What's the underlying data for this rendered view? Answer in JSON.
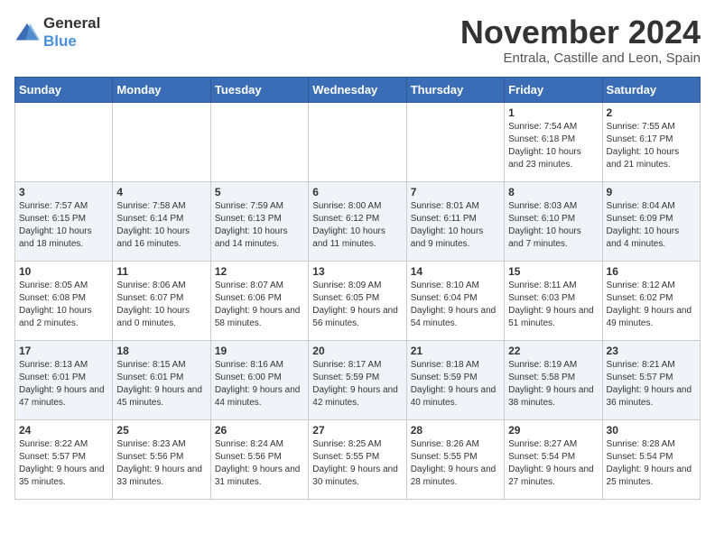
{
  "logo": {
    "general": "General",
    "blue": "Blue"
  },
  "title": "November 2024",
  "location": "Entrala, Castille and Leon, Spain",
  "days_of_week": [
    "Sunday",
    "Monday",
    "Tuesday",
    "Wednesday",
    "Thursday",
    "Friday",
    "Saturday"
  ],
  "weeks": [
    [
      {
        "day": "",
        "info": ""
      },
      {
        "day": "",
        "info": ""
      },
      {
        "day": "",
        "info": ""
      },
      {
        "day": "",
        "info": ""
      },
      {
        "day": "",
        "info": ""
      },
      {
        "day": "1",
        "info": "Sunrise: 7:54 AM\nSunset: 6:18 PM\nDaylight: 10 hours and 23 minutes."
      },
      {
        "day": "2",
        "info": "Sunrise: 7:55 AM\nSunset: 6:17 PM\nDaylight: 10 hours and 21 minutes."
      }
    ],
    [
      {
        "day": "3",
        "info": "Sunrise: 7:57 AM\nSunset: 6:15 PM\nDaylight: 10 hours and 18 minutes."
      },
      {
        "day": "4",
        "info": "Sunrise: 7:58 AM\nSunset: 6:14 PM\nDaylight: 10 hours and 16 minutes."
      },
      {
        "day": "5",
        "info": "Sunrise: 7:59 AM\nSunset: 6:13 PM\nDaylight: 10 hours and 14 minutes."
      },
      {
        "day": "6",
        "info": "Sunrise: 8:00 AM\nSunset: 6:12 PM\nDaylight: 10 hours and 11 minutes."
      },
      {
        "day": "7",
        "info": "Sunrise: 8:01 AM\nSunset: 6:11 PM\nDaylight: 10 hours and 9 minutes."
      },
      {
        "day": "8",
        "info": "Sunrise: 8:03 AM\nSunset: 6:10 PM\nDaylight: 10 hours and 7 minutes."
      },
      {
        "day": "9",
        "info": "Sunrise: 8:04 AM\nSunset: 6:09 PM\nDaylight: 10 hours and 4 minutes."
      }
    ],
    [
      {
        "day": "10",
        "info": "Sunrise: 8:05 AM\nSunset: 6:08 PM\nDaylight: 10 hours and 2 minutes."
      },
      {
        "day": "11",
        "info": "Sunrise: 8:06 AM\nSunset: 6:07 PM\nDaylight: 10 hours and 0 minutes."
      },
      {
        "day": "12",
        "info": "Sunrise: 8:07 AM\nSunset: 6:06 PM\nDaylight: 9 hours and 58 minutes."
      },
      {
        "day": "13",
        "info": "Sunrise: 8:09 AM\nSunset: 6:05 PM\nDaylight: 9 hours and 56 minutes."
      },
      {
        "day": "14",
        "info": "Sunrise: 8:10 AM\nSunset: 6:04 PM\nDaylight: 9 hours and 54 minutes."
      },
      {
        "day": "15",
        "info": "Sunrise: 8:11 AM\nSunset: 6:03 PM\nDaylight: 9 hours and 51 minutes."
      },
      {
        "day": "16",
        "info": "Sunrise: 8:12 AM\nSunset: 6:02 PM\nDaylight: 9 hours and 49 minutes."
      }
    ],
    [
      {
        "day": "17",
        "info": "Sunrise: 8:13 AM\nSunset: 6:01 PM\nDaylight: 9 hours and 47 minutes."
      },
      {
        "day": "18",
        "info": "Sunrise: 8:15 AM\nSunset: 6:01 PM\nDaylight: 9 hours and 45 minutes."
      },
      {
        "day": "19",
        "info": "Sunrise: 8:16 AM\nSunset: 6:00 PM\nDaylight: 9 hours and 44 minutes."
      },
      {
        "day": "20",
        "info": "Sunrise: 8:17 AM\nSunset: 5:59 PM\nDaylight: 9 hours and 42 minutes."
      },
      {
        "day": "21",
        "info": "Sunrise: 8:18 AM\nSunset: 5:59 PM\nDaylight: 9 hours and 40 minutes."
      },
      {
        "day": "22",
        "info": "Sunrise: 8:19 AM\nSunset: 5:58 PM\nDaylight: 9 hours and 38 minutes."
      },
      {
        "day": "23",
        "info": "Sunrise: 8:21 AM\nSunset: 5:57 PM\nDaylight: 9 hours and 36 minutes."
      }
    ],
    [
      {
        "day": "24",
        "info": "Sunrise: 8:22 AM\nSunset: 5:57 PM\nDaylight: 9 hours and 35 minutes."
      },
      {
        "day": "25",
        "info": "Sunrise: 8:23 AM\nSunset: 5:56 PM\nDaylight: 9 hours and 33 minutes."
      },
      {
        "day": "26",
        "info": "Sunrise: 8:24 AM\nSunset: 5:56 PM\nDaylight: 9 hours and 31 minutes."
      },
      {
        "day": "27",
        "info": "Sunrise: 8:25 AM\nSunset: 5:55 PM\nDaylight: 9 hours and 30 minutes."
      },
      {
        "day": "28",
        "info": "Sunrise: 8:26 AM\nSunset: 5:55 PM\nDaylight: 9 hours and 28 minutes."
      },
      {
        "day": "29",
        "info": "Sunrise: 8:27 AM\nSunset: 5:54 PM\nDaylight: 9 hours and 27 minutes."
      },
      {
        "day": "30",
        "info": "Sunrise: 8:28 AM\nSunset: 5:54 PM\nDaylight: 9 hours and 25 minutes."
      }
    ]
  ]
}
